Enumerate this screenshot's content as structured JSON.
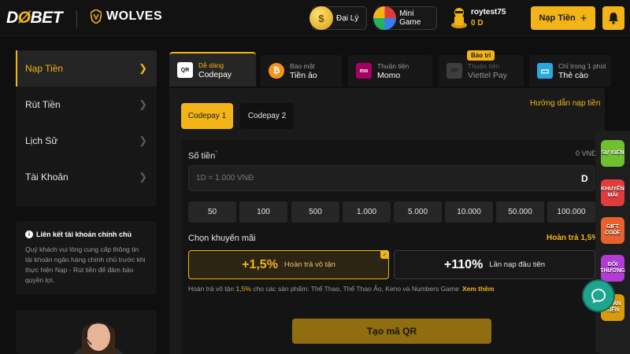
{
  "header": {
    "logo": {
      "part1": "D",
      "part2": "BET"
    },
    "partner": "WOLVES",
    "agent_label": "Đại Lý",
    "mini_game_label": "Mini Game",
    "username": "roytest75",
    "balance": "0 D",
    "deposit_label": "Nạp Tiền",
    "deposit_plus": "+"
  },
  "sidebar": {
    "items": [
      {
        "label": "Nạp Tiền",
        "active": true
      },
      {
        "label": "Rút Tiền",
        "active": false
      },
      {
        "label": "Lịch Sử",
        "active": false
      },
      {
        "label": "Tài Khoản",
        "active": false
      }
    ],
    "chevron": "❯"
  },
  "info": {
    "title": "Liên kết tài khoản chính chủ",
    "text": "Quý khách vui lòng cung cấp thông tin tài khoản ngân hàng chính chủ trước khi thực hiện Nạp - Rút tiền để đảm bảo quyền lợi."
  },
  "methods": [
    {
      "sub": "Dễ dàng",
      "main": "Codepay",
      "icon": "QR"
    },
    {
      "sub": "Bảo mật",
      "main": "Tiền ảo",
      "icon": "₿"
    },
    {
      "sub": "Thuận tiện",
      "main": "Momo",
      "icon": "mo"
    },
    {
      "sub": "Thuận tiện",
      "main": "Viettel Pay",
      "icon": "VP"
    },
    {
      "sub": "Chỉ trong 1 phút",
      "main": "Thẻ cào",
      "icon": "▭"
    }
  ],
  "maintenance_badge": "Bảo trì",
  "guide_link": "Hướng dẫn nạp tiền",
  "codepay_tabs": [
    "Codepay 1",
    "Codepay 2"
  ],
  "form": {
    "amount_label": "Số tiền",
    "required_mark": "*",
    "amount_value_display": "0 VNĐ",
    "amount_placeholder": "1D = 1.000 VNĐ",
    "currency_symbol": "D",
    "quick_amounts": [
      "50",
      "100",
      "500",
      "1.000",
      "5.000",
      "10.000",
      "50.000",
      "100.000"
    ],
    "promo_label": "Chọn khuyến mãi",
    "promo_rebate": "Hoàn trả 1,5%",
    "promos": [
      {
        "big": "+1,5%",
        "small": "Hoàn trả vô tận",
        "selected": true
      },
      {
        "big": "+110%",
        "small": "Lần nạp đầu tiên",
        "selected": false
      }
    ],
    "note_prefix": "Hoàn trả vô tận ",
    "note_rate": "1,5%",
    "note_suffix": " cho các sản phẩm: Thể Thao, Thể Thao Ảo, Keno và Numbers Game",
    "note_more": "Xem thêm",
    "submit_label": "Tạo mã QR"
  },
  "rail": [
    {
      "label": "SỰ KIỆN",
      "color": "#6fbf2f"
    },
    {
      "label": "KHUYẾN MÃI",
      "color": "#e23b3b"
    },
    {
      "label": "GIFT CODE",
      "color": "#e8612c"
    },
    {
      "label": "ĐỔI THƯỞNG",
      "color": "#b23bd6"
    },
    {
      "label": "HOÀN TIỀN",
      "color": "#d99a0c"
    }
  ]
}
